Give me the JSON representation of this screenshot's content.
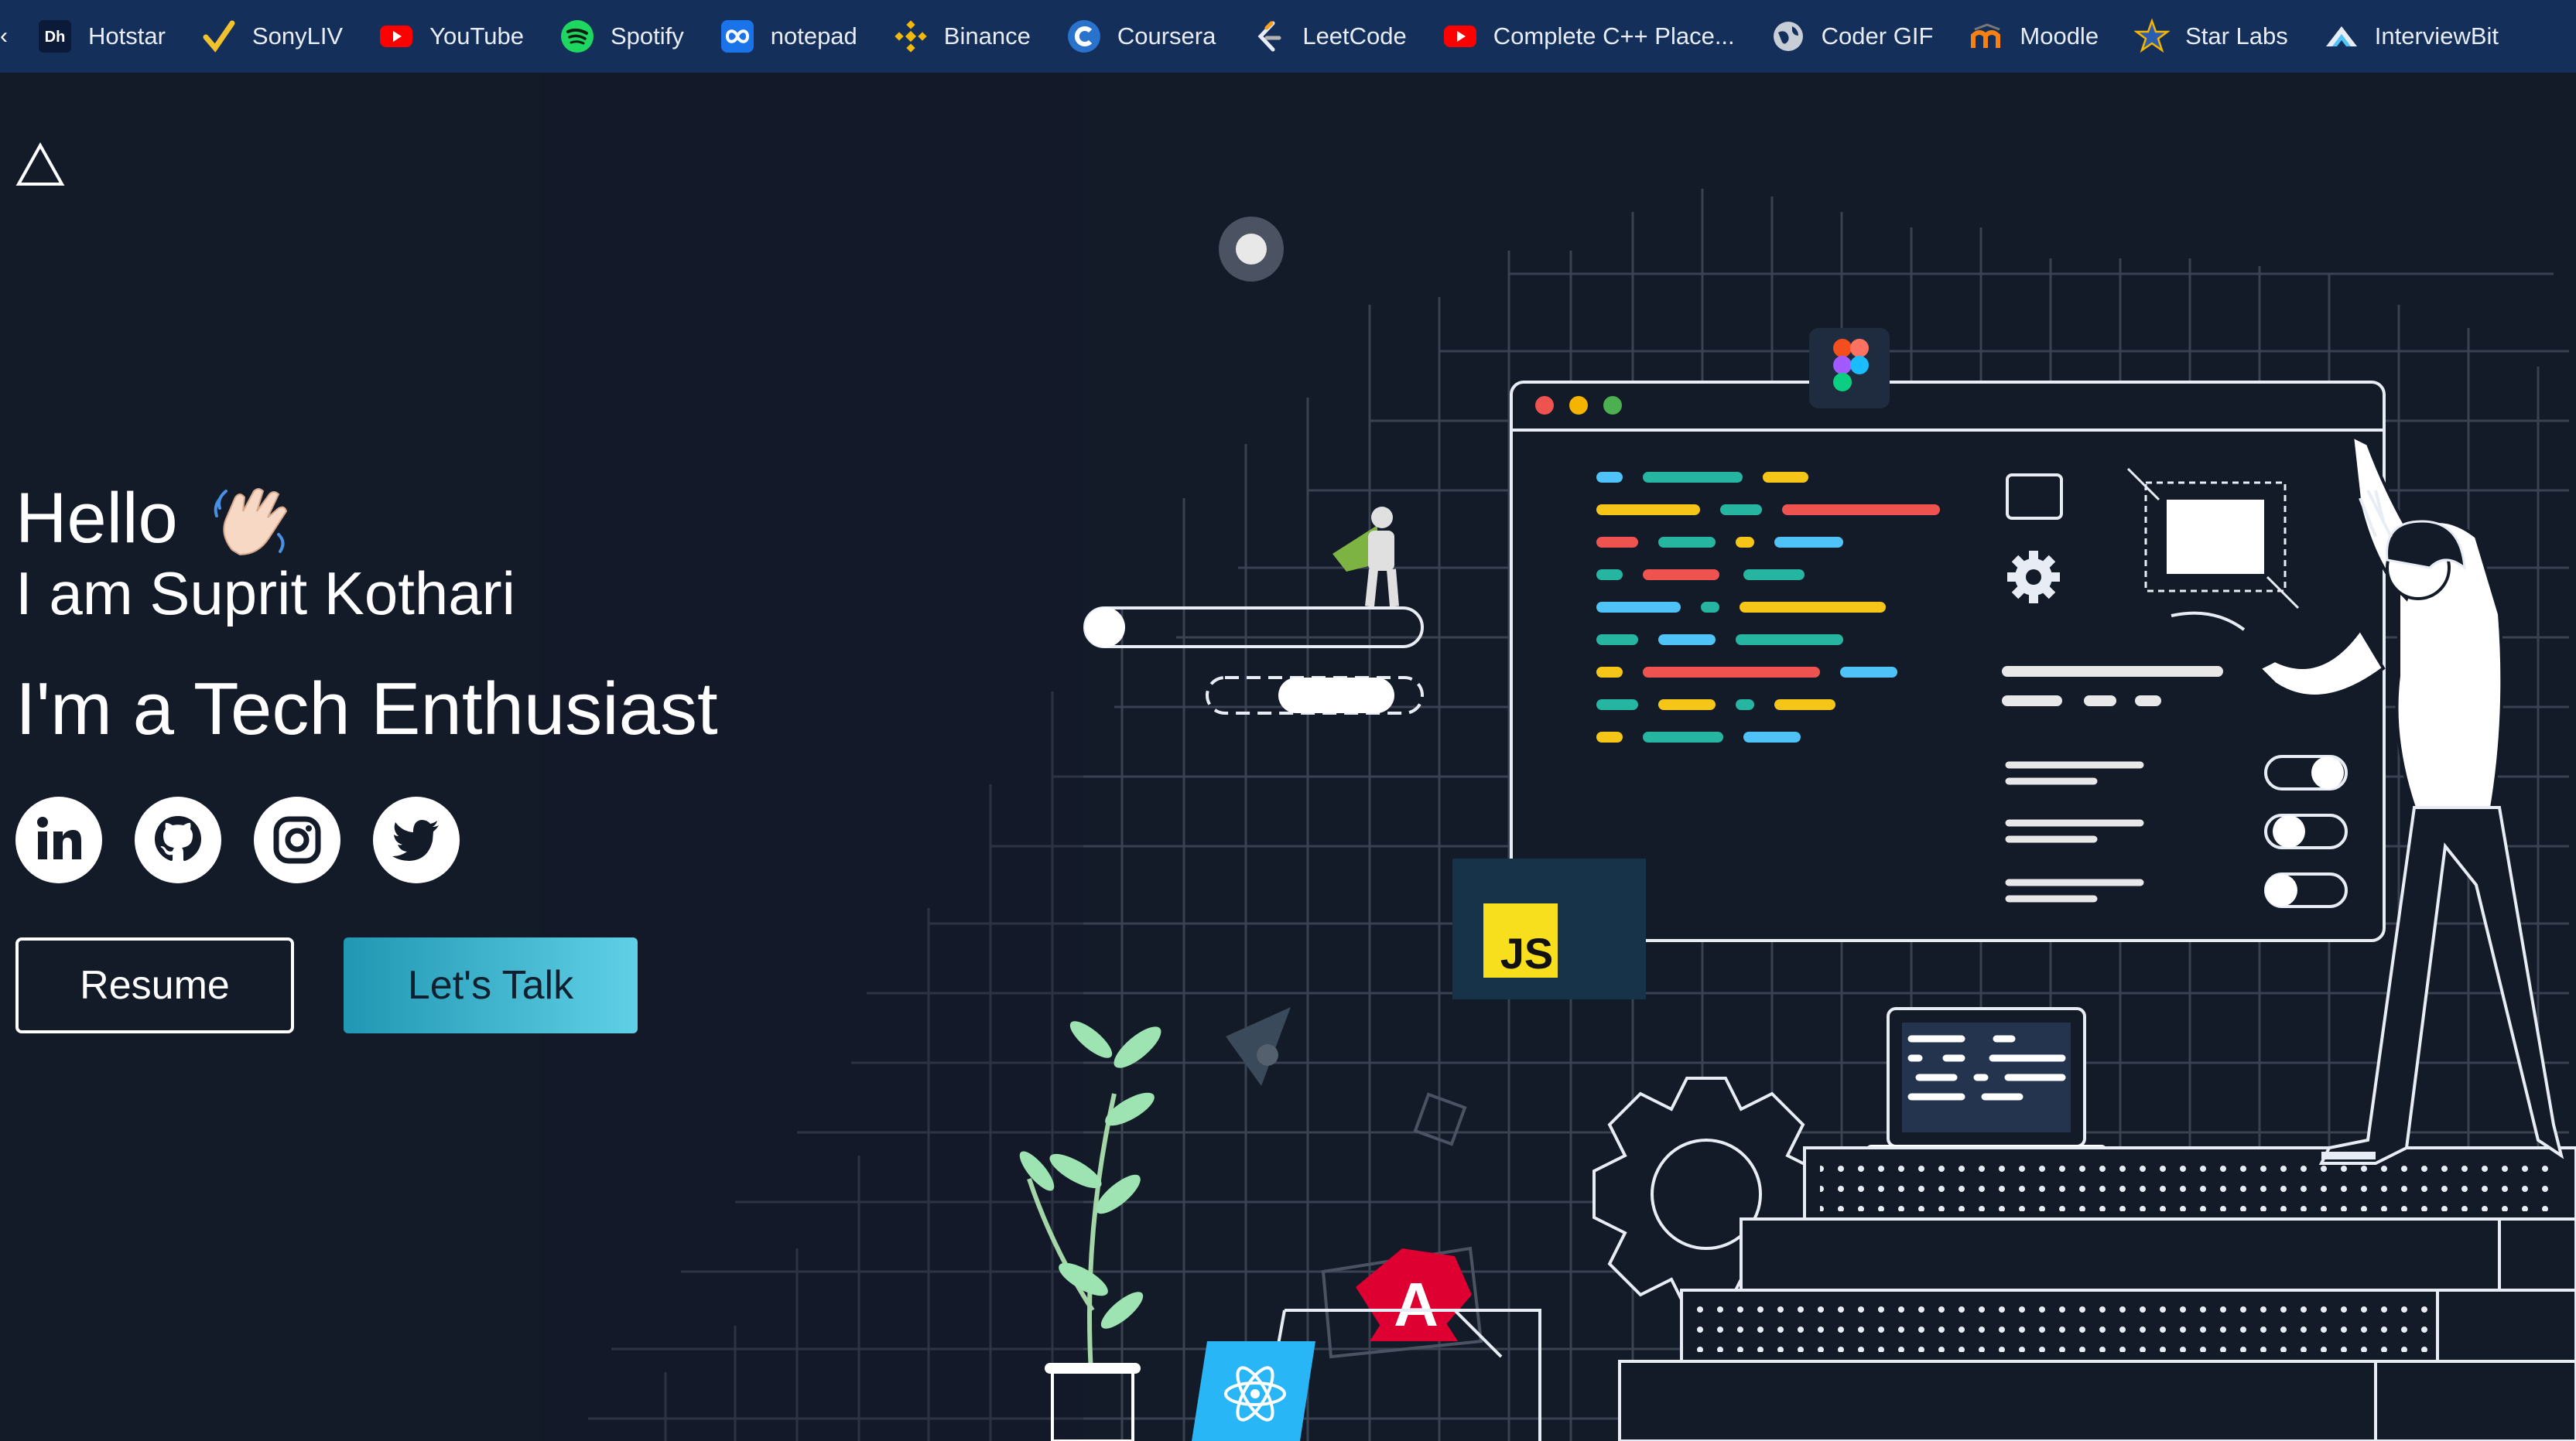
{
  "bookmarks": [
    {
      "label": "Hotstar",
      "icon": "hotstar-icon"
    },
    {
      "label": "SonyLIV",
      "icon": "sonyliv-icon"
    },
    {
      "label": "YouTube",
      "icon": "youtube-icon"
    },
    {
      "label": "Spotify",
      "icon": "spotify-icon"
    },
    {
      "label": "notepad",
      "icon": "notepad-icon"
    },
    {
      "label": "Binance",
      "icon": "binance-icon"
    },
    {
      "label": "Coursera",
      "icon": "coursera-icon"
    },
    {
      "label": "LeetCode",
      "icon": "leetcode-icon"
    },
    {
      "label": "Complete C++ Place...",
      "icon": "youtube-icon"
    },
    {
      "label": "Coder GIF",
      "icon": "globe-icon"
    },
    {
      "label": "Moodle",
      "icon": "moodle-icon"
    },
    {
      "label": "Star Labs",
      "icon": "star-icon"
    },
    {
      "label": "InterviewBit",
      "icon": "interviewbit-icon"
    }
  ],
  "hero": {
    "greeting": "Hello",
    "name_line": "I am Suprit Kothari",
    "role_line": "I'm a Tech Enthusiast"
  },
  "socials": [
    "linkedin-icon",
    "github-icon",
    "instagram-icon",
    "twitter-icon"
  ],
  "buttons": {
    "resume": "Resume",
    "talk": "Let's Talk"
  },
  "illustration": {
    "js_badge": "JS"
  },
  "colors": {
    "background": "#131a28",
    "bookmark_bar": "#14305a",
    "accent_start": "#2197b3",
    "accent_end": "#5fd0e6"
  }
}
